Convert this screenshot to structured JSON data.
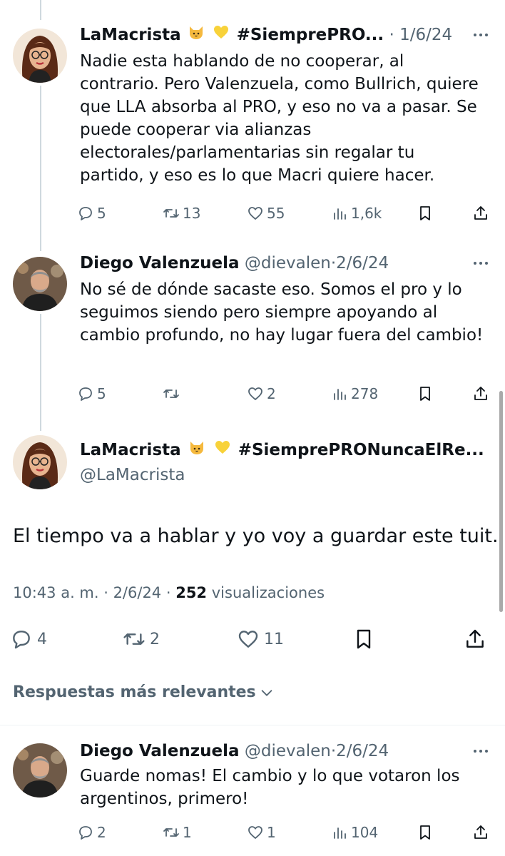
{
  "tweets": [
    {
      "name": "LaMacrista",
      "hashtag": "#SiemprePRO...",
      "separator": "·",
      "date": "1/6/24",
      "text": "Nadie esta hablando de no cooperar, al contrario. Pero Valenzuela, como Bullrich, quiere que LLA absorba al PRO, y eso no va a pasar. Se puede cooperar via alianzas electorales/parlamentarias sin regalar tu partido, y eso es lo que Macri quiere hacer.",
      "replies": "5",
      "retweets": "13",
      "likes": "55",
      "views": "1,6k"
    },
    {
      "name": "Diego Valenzuela",
      "handle": "@dievalen",
      "separator": "·",
      "date": "2/6/24",
      "text": "No sé de dónde sacaste eso. Somos el pro y lo seguimos siendo pero siempre apoyando al cambio profundo, no hay lugar fuera del cambio!",
      "replies": "5",
      "retweets": "",
      "likes": "2",
      "views": "278"
    }
  ],
  "main_tweet": {
    "name": "LaMacrista",
    "hashtag": "#SiemprePRONuncaElRe...",
    "handle": "@LaMacrista",
    "text": "El tiempo va a hablar y yo voy a guardar este tuit.",
    "time": "10:43 a. m. · 2/6/24 ·",
    "views_count": "252",
    "views_label": "visualizaciones",
    "replies": "4",
    "retweets": "2",
    "likes": "11"
  },
  "replies_heading": "Respuestas más relevantes",
  "reply": {
    "name": "Diego Valenzuela",
    "handle": "@dievalen",
    "separator": "·",
    "date": "2/6/24",
    "text": "Guarde nomas! El cambio y lo que votaron los argentinos, primero!",
    "replies": "2",
    "retweets": "1",
    "likes": "1",
    "views": "104"
  },
  "icons": {
    "cat": "cat-face-emoji",
    "heart": "yellow-heart-emoji"
  },
  "colors": {
    "text": "#0f1419",
    "secondary": "#536471",
    "thread_line": "#cfd9de"
  }
}
